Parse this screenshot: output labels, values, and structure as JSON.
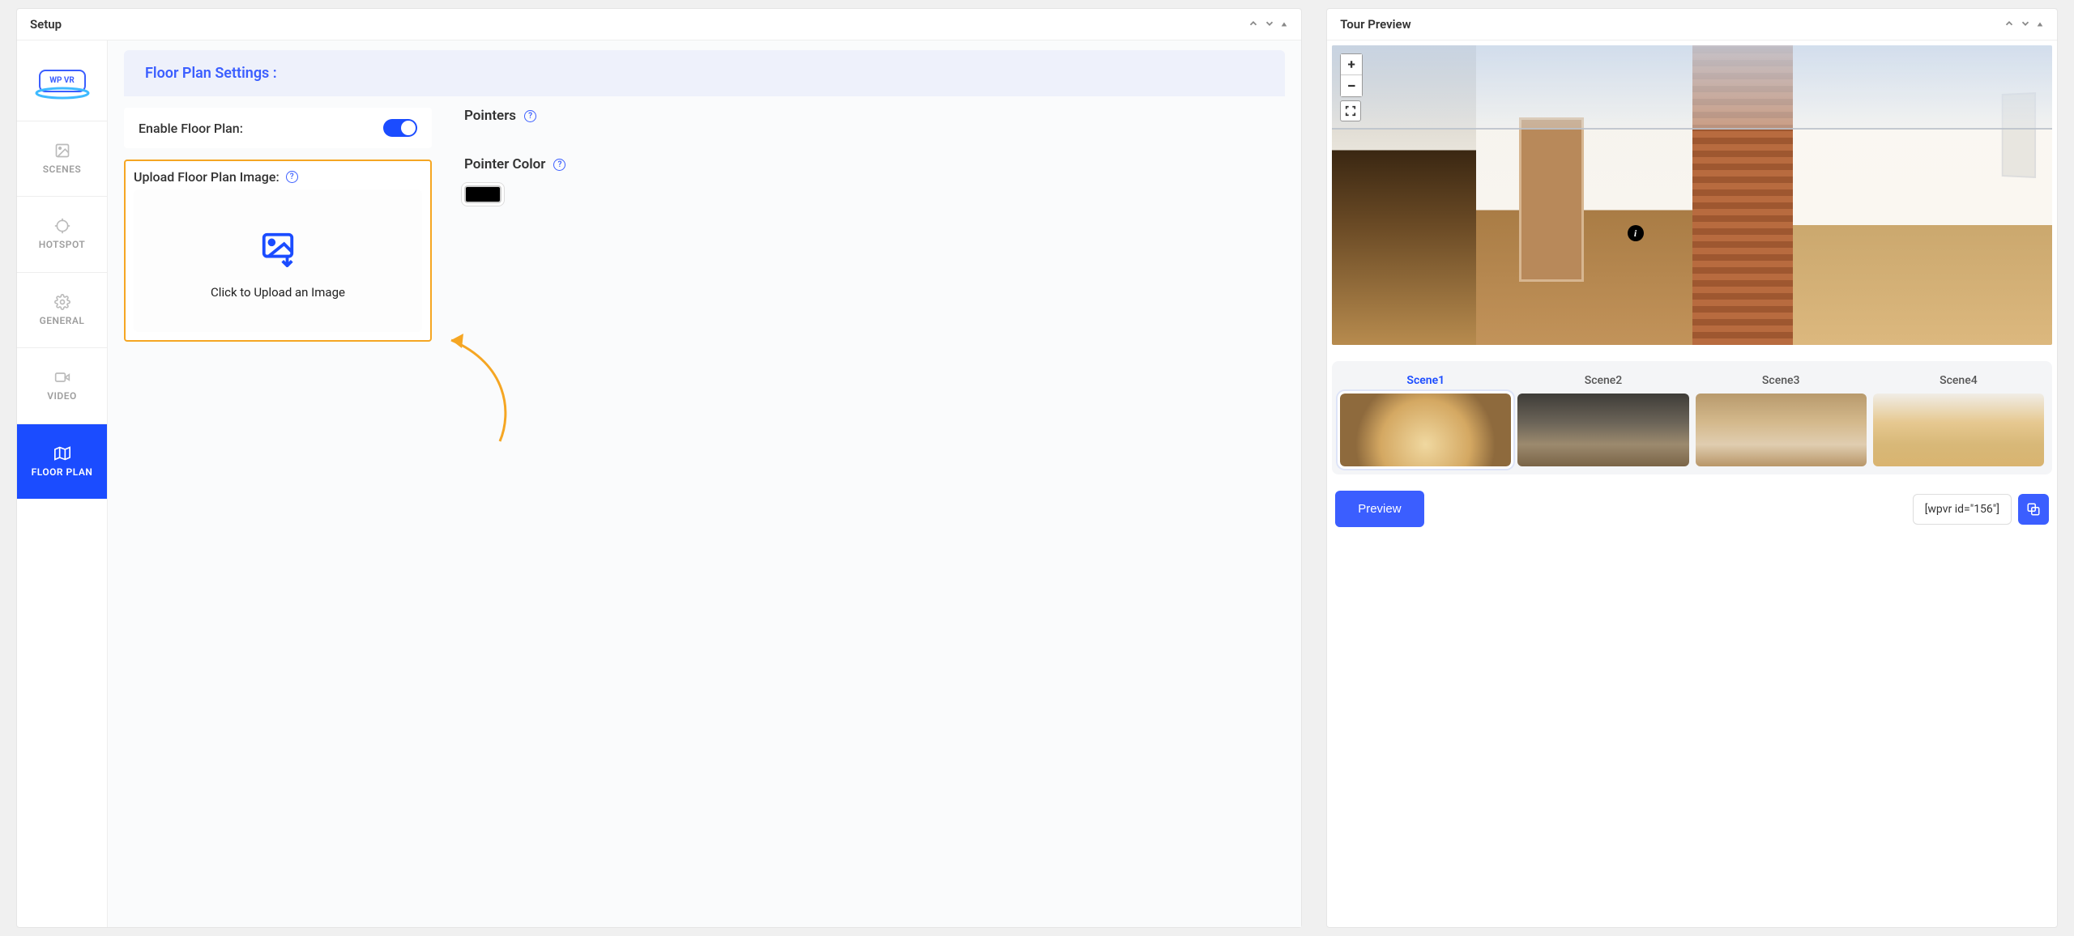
{
  "setup": {
    "title": "Setup",
    "logo_text": "WP VR",
    "nav": {
      "scenes": "SCENES",
      "hotspot": "HOTSPOT",
      "general": "GENERAL",
      "video": "VIDEO",
      "floorplan": "FLOOR PLAN"
    },
    "floorplan": {
      "header": "Floor Plan Settings :",
      "enable_label": "Enable Floor Plan:",
      "upload_label": "Upload Floor Plan Image:",
      "upload_cta": "Click to Upload an Image",
      "pointers_label": "Pointers",
      "pointer_color_label": "Pointer Color",
      "pointer_color_value": "#000000"
    }
  },
  "preview": {
    "title": "Tour Preview",
    "zoom_in": "+",
    "zoom_out": "−",
    "hotspot_info": "i",
    "scenes": [
      "Scene1",
      "Scene2",
      "Scene3",
      "Scene4"
    ],
    "preview_btn": "Preview",
    "shortcode": "[wpvr id=\"156\"]"
  }
}
